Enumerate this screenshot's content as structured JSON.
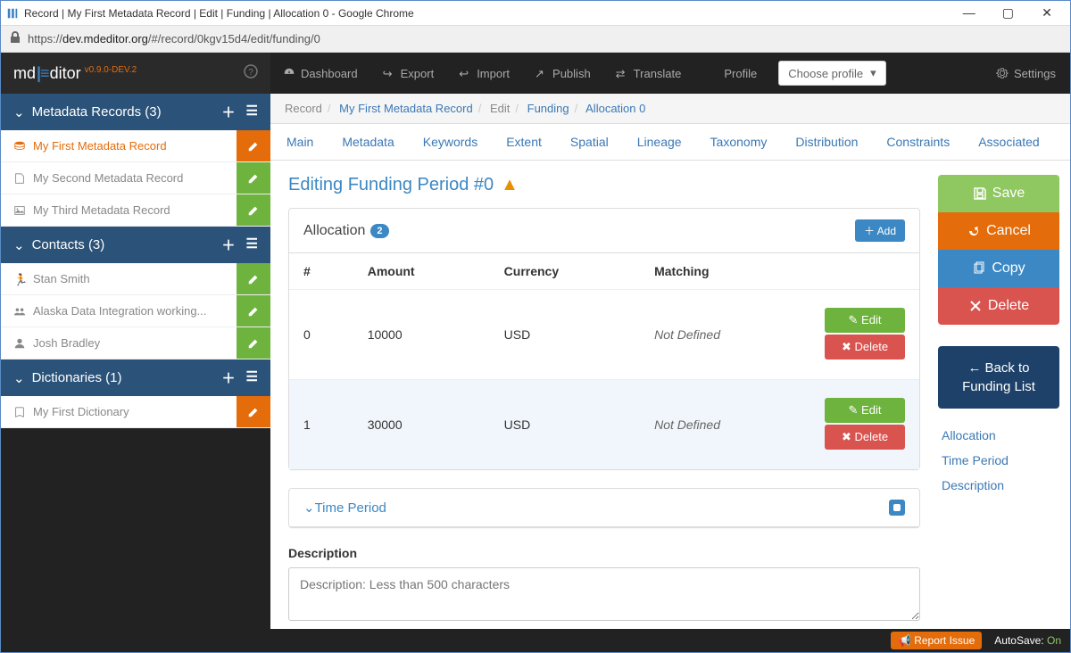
{
  "window": {
    "title": "Record | My First Metadata Record | Edit | Funding | Allocation 0 - Google Chrome",
    "url_prefix": "https://",
    "url_domain": "dev.mdeditor.org",
    "url_path": "/#/record/0kgv15d4/edit/funding/0"
  },
  "brand": {
    "m": "md",
    "d": "ditor",
    "version": "v0.9.0-DEV.2"
  },
  "topnav": {
    "dashboard": "Dashboard",
    "export": "Export",
    "import": "Import",
    "publish": "Publish",
    "translate": "Translate",
    "profile_label": "Profile",
    "profile_select": "Choose profile",
    "settings": "Settings"
  },
  "sidebar": {
    "records_header": "Metadata Records (3)",
    "records": [
      {
        "label": "My First Metadata Record",
        "active": true
      },
      {
        "label": "My Second Metadata Record",
        "active": false
      },
      {
        "label": "My Third Metadata Record",
        "active": false
      }
    ],
    "contacts_header": "Contacts (3)",
    "contacts": [
      {
        "label": "Stan Smith"
      },
      {
        "label": "Alaska Data Integration working..."
      },
      {
        "label": "Josh Bradley"
      }
    ],
    "dict_header": "Dictionaries (1)",
    "dicts": [
      {
        "label": "My First Dictionary"
      }
    ]
  },
  "breadcrumb": {
    "p0": "Record",
    "p1": "My First Metadata Record",
    "p2": "Edit",
    "p3": "Funding",
    "p4": "Allocation 0"
  },
  "tabs": {
    "main": "Main",
    "metadata": "Metadata",
    "keywords": "Keywords",
    "extent": "Extent",
    "spatial": "Spatial",
    "lineage": "Lineage",
    "taxonomy": "Taxonomy",
    "distribution": "Distribution",
    "constraints": "Constraints",
    "associated": "Associated"
  },
  "page": {
    "title": "Editing Funding Period #0",
    "allocation_label": "Allocation",
    "allocation_count": "2",
    "add_label": "Add",
    "col_idx": "#",
    "col_amount": "Amount",
    "col_currency": "Currency",
    "col_matching": "Matching",
    "rows": [
      {
        "idx": "0",
        "amount": "10000",
        "currency": "USD",
        "matching": "Not Defined"
      },
      {
        "idx": "1",
        "amount": "30000",
        "currency": "USD",
        "matching": "Not Defined"
      }
    ],
    "row_edit": "Edit",
    "row_delete": "Delete",
    "time_period": "Time Period",
    "description_label": "Description",
    "description_placeholder": "Description: Less than 500 characters"
  },
  "actions": {
    "save": "Save",
    "cancel": "Cancel",
    "copy": "Copy",
    "delete": "Delete",
    "back": "Back to Funding List",
    "anchors": {
      "allocation": "Allocation",
      "time": "Time Period",
      "desc": "Description"
    }
  },
  "footer": {
    "report": "Report Issue",
    "autosave_lbl": "AutoSave:",
    "autosave_state": "On"
  }
}
